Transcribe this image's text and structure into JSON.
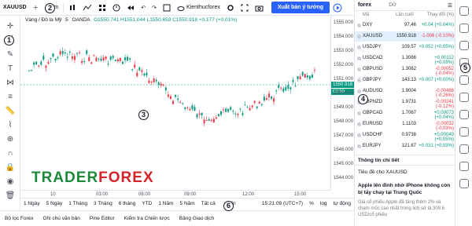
{
  "topbar": {
    "symbol": "XAUUSD",
    "interval": "5m",
    "layout_name": "Kienthucforex",
    "publish_label": "Xuất bản ý tưởng"
  },
  "chart": {
    "legend_title": "Vàng / Đô la Mỹ",
    "legend_interval": "5",
    "legend_source": "OANDA",
    "ohlc": "O1550.741 H1551.044 L1550.659 C1550.918 +0.177 (+0.01%)",
    "price_labels": [
      "1555.000",
      "1554.000",
      "1553.000",
      "1552.000",
      "1551.000",
      "1550.000",
      "1549.000",
      "1548.000",
      "1547.000",
      "1546.000",
      "1545.000",
      "1544.000"
    ],
    "current_price": "1550.918",
    "countdown": "03:50",
    "time_labels": [
      "10",
      "03:00",
      "06:00",
      "09:00",
      "12:00",
      "15:00"
    ]
  },
  "watermark": {
    "part1": "TRADER",
    "part2": "FOREX"
  },
  "range_bar": {
    "items": [
      "1 Ngày",
      "5 Ngày",
      "1 Tháng",
      "3 Tháng",
      "6 tháng",
      "YTD",
      "1 Năm",
      "5 Năm",
      "Tất cả"
    ],
    "goto": "Đến",
    "time": "15:21:09 (UTC+7)",
    "pct": "%",
    "log": "log",
    "auto": "tự động"
  },
  "bottom_tabs": [
    "Bộ lọc Forex",
    "Ghi chú văn bản",
    "Pine Editor",
    "Kiểm tra Chiến lược",
    "Bảng Giao dịch"
  ],
  "watchlist": {
    "title": "forex",
    "search_placeholder": "Dữ",
    "col_symbol": "Mã",
    "col_last": "Lần cuối",
    "col_change": "Thay đổi (%)",
    "rows": [
      {
        "sym": "DXY",
        "last": "97.46",
        "chg": "+0.04 (+0.04%)",
        "dir": "pos"
      },
      {
        "sym": "XAUUSD",
        "last": "1550.918",
        "chg": "-1.006 (-0.10%)",
        "dir": "neg",
        "selected": true
      },
      {
        "sym": "USDJPY",
        "last": "109.57",
        "chg": "+0.052 (+0.05%)",
        "dir": "pos"
      },
      {
        "sym": "USDCAD",
        "last": "1.3066",
        "chg": "+0.00112 (+0.09%)",
        "dir": "pos"
      },
      {
        "sym": "GBPUSD",
        "last": "1.3062",
        "chg": "-0.00052 (-0.04%)",
        "dir": "neg"
      },
      {
        "sym": "GBPJPY",
        "last": "143.13",
        "chg": "+0.007 (+0.00%)",
        "dir": "pos"
      },
      {
        "sym": "AUDUSD",
        "last": "1.9004",
        "chg": "-0.00486 (-0.26%)",
        "dir": "neg"
      },
      {
        "sym": "GBPNZD",
        "last": "1.9731",
        "chg": "-0.00241 (-0.12%)",
        "dir": "neg"
      },
      {
        "sym": "GBPCAD",
        "last": "1.7067",
        "chg": "+0.00073 (+0.04%)",
        "dir": "pos"
      },
      {
        "sym": "EURUSD",
        "last": "1.1103",
        "chg": "-0.00032 (-0.03%)",
        "dir": "neg"
      },
      {
        "sym": "USDCHF",
        "last": "0.9738",
        "chg": "+0.00049 (+0.05%)",
        "dir": "pos"
      },
      {
        "sym": "EURJPY",
        "last": "121.67",
        "chg": "+0.031 (+0.03%)",
        "dir": "pos"
      }
    ]
  },
  "details": {
    "title": "Thông tin chi tiết",
    "news_header": "Tiêu đề cho XAUUSD",
    "news_title": "Apple lên đỉnh nhờ iPhone không còn bị tẩy chay tại Trung Quốc",
    "news_body": "Giá cổ phiếu Apple đã tăng thêm 2% và chạm mốc cao nhất trong lịch sử là 309.6 USD/cổ phiếu"
  },
  "callouts": [
    "1",
    "2",
    "3",
    "4",
    "5",
    "6"
  ],
  "colors": {
    "up": "#089981",
    "down": "#f23645",
    "accent": "#2962ff"
  }
}
